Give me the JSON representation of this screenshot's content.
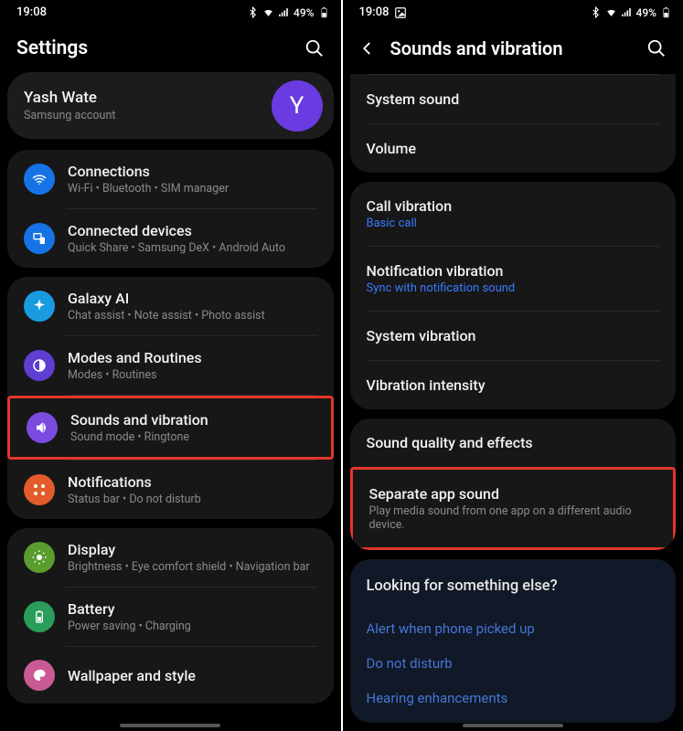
{
  "status": {
    "time": "19:08",
    "battery_pct": "49%"
  },
  "left": {
    "title": "Settings",
    "account": {
      "name": "Yash Wate",
      "sub": "Samsung account",
      "initial": "Y"
    },
    "groups": [
      {
        "items": [
          {
            "title": "Connections",
            "sub": "Wi-Fi  •  Bluetooth  •  SIM manager"
          },
          {
            "title": "Connected devices",
            "sub": "Quick Share  •  Samsung DeX  •  Android Auto"
          }
        ]
      },
      {
        "items": [
          {
            "title": "Galaxy AI",
            "sub": "Chat assist  •  Note assist  •  Photo assist"
          },
          {
            "title": "Modes and Routines",
            "sub": "Modes  •  Routines"
          },
          {
            "title": "Sounds and vibration",
            "sub": "Sound mode  •  Ringtone"
          },
          {
            "title": "Notifications",
            "sub": "Status bar  •  Do not disturb"
          }
        ]
      },
      {
        "items": [
          {
            "title": "Display",
            "sub": "Brightness  •  Eye comfort shield  •  Navigation bar"
          },
          {
            "title": "Battery",
            "sub": "Power saving  •  Charging"
          },
          {
            "title": "Wallpaper and style",
            "sub": ""
          }
        ]
      }
    ]
  },
  "right": {
    "title": "Sounds and vibration",
    "groups": [
      {
        "items": [
          {
            "title": "System sound"
          },
          {
            "title": "Volume"
          }
        ]
      },
      {
        "items": [
          {
            "title": "Call vibration",
            "sub": "Basic call",
            "link": true
          },
          {
            "title": "Notification vibration",
            "sub": "Sync with notification sound",
            "link": true
          },
          {
            "title": "System vibration"
          },
          {
            "title": "Vibration intensity"
          }
        ]
      },
      {
        "items": [
          {
            "title": "Sound quality and effects"
          },
          {
            "title": "Separate app sound",
            "sub": "Play media sound from one app on a different audio device."
          }
        ]
      }
    ],
    "hint": {
      "title": "Looking for something else?",
      "links": [
        "Alert when phone picked up",
        "Do not disturb",
        "Hearing enhancements"
      ]
    }
  }
}
